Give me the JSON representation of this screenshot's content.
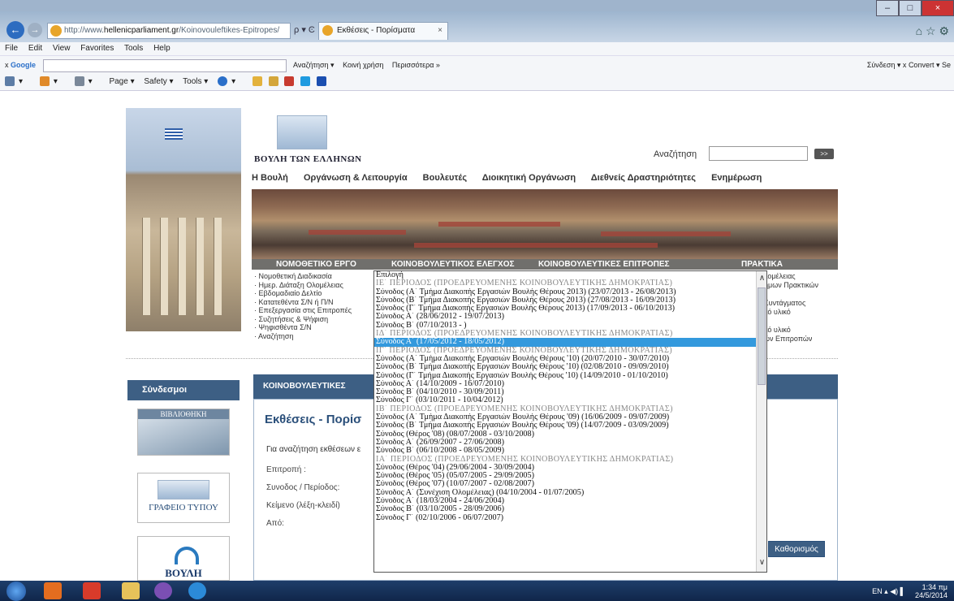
{
  "browser": {
    "url_prefix": "http://www.",
    "url_domain": "hellenicparliament.gr",
    "url_rest": "/Koinovouleftikes-Epitropes/",
    "address_tools": "ρ ▾ Ͼ",
    "tab_title": "Εκθέσεις - Πορίσματα",
    "tab_close": "×",
    "window_controls": [
      "–",
      "□",
      "×"
    ],
    "right_icons": "⌂ ☆ ⚙"
  },
  "menubar": [
    "File",
    "Edit",
    "View",
    "Favorites",
    "Tools",
    "Help"
  ],
  "googlebar": {
    "close": "x",
    "label": "Google",
    "buttons": [
      "Αναζήτηση ▾",
      "Κοινή χρήση",
      "Περισσότερα »"
    ],
    "right": [
      "Σύνδεση ▾",
      "x",
      "Convert ▾",
      "Se"
    ]
  },
  "cmdbar": [
    "▾",
    "▾",
    "▾",
    "Page ▾",
    "Safety ▾",
    "Tools ▾",
    "▾"
  ],
  "site": {
    "logo_text": "ΒΟΥΛΗ ΤΩΝ ΕΛΛΗΝΩΝ",
    "search_label": "Αναζήτηση",
    "search_go": ">>",
    "nav": [
      "Η Βουλή",
      "Οργάνωση & Λειτουργία",
      "Βουλευτές",
      "Διοικητική Οργάνωση",
      "Διεθνείς Δραστηριότητες",
      "Ενημέρωση"
    ],
    "sections": [
      "ΝΟΜΟΘΕΤΙΚΟ ΕΡΓΟ",
      "ΚΟΙΝΟΒΟΥΛΕΥΤΙΚΟΣ ΕΛΕΓΧΟΣ",
      "ΚΟΙΝΟΒΟΥΛΕΥΤΙΚΕΣ ΕΠΙΤΡΟΠΕΣ",
      "ΠΡΑΚΤΙΚΑ"
    ],
    "legislative_items": [
      "Νομοθετική Διαδικασία",
      "Ημερ. Διάταξη Ολομέλειας",
      "Εβδομαδιαίο Δελτίο",
      "Κατατεθέντα Σ/Ν ή Π/Ν",
      "Επεξεργασία στις Επιτροπές",
      "Συζητήσεις & Ψήφιση",
      "Ψηφισθέντα Σ/Ν",
      "Αναζήτηση"
    ],
    "right_fragments": [
      "λομέλειας",
      "ημων Πρακτικών",
      "",
      "Συντάγματος",
      "κό υλικό",
      "",
      "κό υλικό",
      "ών Επιτροπών"
    ],
    "links_heading": "Σύνδεσμοι",
    "link_library": "ΒΙΒΛΙΟΘΗΚΗ",
    "link_press": "ΓΡΑΦΕΙΟ ΤΥΠΟΥ",
    "link_vouli": "ΒΟΥΛΗ",
    "content_heading": "ΚΟΙΝΟΒΟΥΛΕΥΤΙΚΕΣ",
    "content_title": "Εκθέσεις - Πορίσ",
    "content_intro": "Για αναζήτηση εκθέσεων ε",
    "fields": [
      "Επιτροπή :",
      "Συνοδος / Περίοδος:",
      "Κείμενο (λέξη-κλειδί)",
      "Από:"
    ],
    "define_button": "Καθορισμός"
  },
  "dropdown": {
    "options": [
      {
        "text": "Επιλογή",
        "kind": "opt"
      },
      {
        "text": "ΙΕ΄ ΠΕΡΙΟΔΟΣ (ΠΡΟΕΔΡΕΥΟΜΕΝΗΣ ΚΟΙΝΟΒΟΥΛΕΥΤΙΚΗΣ ΔΗΜΟΚΡΑΤΙΑΣ)",
        "kind": "group"
      },
      {
        "text": "Σύνοδος (Α΄ Τμήμα Διακοπής Εργασιών Βουλής Θέρους 2013) (23/07/2013 - 26/08/2013)",
        "kind": "opt"
      },
      {
        "text": "Σύνοδος (Β΄ Τμήμα Διακοπής Εργασιών Βουλής Θέρους 2013) (27/08/2013 - 16/09/2013)",
        "kind": "opt"
      },
      {
        "text": "Σύνοδος (Γ΄ Τμήμα Διακοπής Εργασιών Βουλής Θέρους 2013) (17/09/2013 - 06/10/2013)",
        "kind": "opt"
      },
      {
        "text": "Σύνοδος Α΄ (28/06/2012 - 19/07/2013)",
        "kind": "opt"
      },
      {
        "text": "Σύνοδος Β΄ (07/10/2013 - )",
        "kind": "opt"
      },
      {
        "text": "ΙΔ΄ ΠΕΡΙΟΔΟΣ (ΠΡΟΕΔΡΕΥΟΜΕΝΗΣ ΚΟΙΝΟΒΟΥΛΕΥΤΙΚΗΣ ΔΗΜΟΚΡΑΤΙΑΣ)",
        "kind": "group"
      },
      {
        "text": "Σύνοδος Α΄ (17/05/2012 - 18/05/2012)",
        "kind": "selected"
      },
      {
        "text": "ΙΓ΄ ΠΕΡΙΟΔΟΣ (ΠΡΟΕΔΡΕΥΟΜΕΝΗΣ ΚΟΙΝΟΒΟΥΛΕΥΤΙΚΗΣ ΔΗΜΟΚΡΑΤΙΑΣ)",
        "kind": "group"
      },
      {
        "text": "Σύνοδος (Α΄ Τμήμα Διακοπής Εργασιών Βουλής Θέρους '10) (20/07/2010 - 30/07/2010)",
        "kind": "opt"
      },
      {
        "text": "Σύνοδος (Β΄ Τμήμα Διακοπής Εργασιών Βουλής Θέρους '10) (02/08/2010 - 09/09/2010)",
        "kind": "opt"
      },
      {
        "text": "Σύνοδος (Γ΄ Τμήμα Διακοπής Εργασιών Βουλής Θέρους '10) (14/09/2010 - 01/10/2010)",
        "kind": "opt"
      },
      {
        "text": "Σύνοδος Α΄ (14/10/2009 - 16/07/2010)",
        "kind": "opt"
      },
      {
        "text": "Σύνοδος Β΄ (04/10/2010 - 30/09/2011)",
        "kind": "opt"
      },
      {
        "text": "Σύνοδος Γ΄ (03/10/2011 - 10/04/2012)",
        "kind": "opt"
      },
      {
        "text": "ΙΒ΄ ΠΕΡΙΟΔΟΣ (ΠΡΟΕΔΡΕΥΟΜΕΝΗΣ ΚΟΙΝΟΒΟΥΛΕΥΤΙΚΗΣ ΔΗΜΟΚΡΑΤΙΑΣ)",
        "kind": "group"
      },
      {
        "text": "Σύνοδος (Α΄ Τμήμα Διακοπής Εργασιών Βουλής Θέρους '09) (16/06/2009 - 09/07/2009)",
        "kind": "opt"
      },
      {
        "text": "Σύνοδος (Β΄ Τμήμα Διακοπής Εργασιών Βουλής Θέρους '09) (14/07/2009 - 03/09/2009)",
        "kind": "opt"
      },
      {
        "text": "Σύνοδος (Θέρος '08) (08/07/2008 - 03/10/2008)",
        "kind": "opt"
      },
      {
        "text": "Σύνοδος Α΄ (26/09/2007 - 27/06/2008)",
        "kind": "opt"
      },
      {
        "text": "Σύνοδος Β΄ (06/10/2008 - 08/05/2009)",
        "kind": "opt"
      },
      {
        "text": "ΙΑ΄ ΠΕΡΙΟΔΟΣ (ΠΡΟΕΔΡΕΥΟΜΕΝΗΣ ΚΟΙΝΟΒΟΥΛΕΥΤΙΚΗΣ ΔΗΜΟΚΡΑΤΙΑΣ)",
        "kind": "group"
      },
      {
        "text": "Σύνοδος (Θέρος '04) (29/06/2004 - 30/09/2004)",
        "kind": "opt"
      },
      {
        "text": "Σύνοδος (Θέρος '05) (05/07/2005 - 29/09/2005)",
        "kind": "opt"
      },
      {
        "text": "Σύνοδος (Θέρος '07) (10/07/2007 - 02/08/2007)",
        "kind": "opt"
      },
      {
        "text": "Σύνοδος Α΄ (Συνέχιση Ολομέλειας) (04/10/2004 - 01/07/2005)",
        "kind": "opt"
      },
      {
        "text": "Σύνοδος Α΄ (18/03/2004 - 24/06/2004)",
        "kind": "opt"
      },
      {
        "text": "Σύνοδος Β΄ (03/10/2005 - 28/09/2006)",
        "kind": "opt"
      },
      {
        "text": "Σύνοδος Γ΄ (02/10/2006 - 06/07/2007)",
        "kind": "opt"
      }
    ],
    "scroll_up": "∧",
    "scroll_down": "∨"
  },
  "taskbar": {
    "lang": "EN",
    "time": "1:34 πμ",
    "date": "24/5/2014"
  },
  "colors": {
    "accent": "#3d5f84",
    "selection": "#3399dd",
    "section_bar": "#706f6c"
  }
}
